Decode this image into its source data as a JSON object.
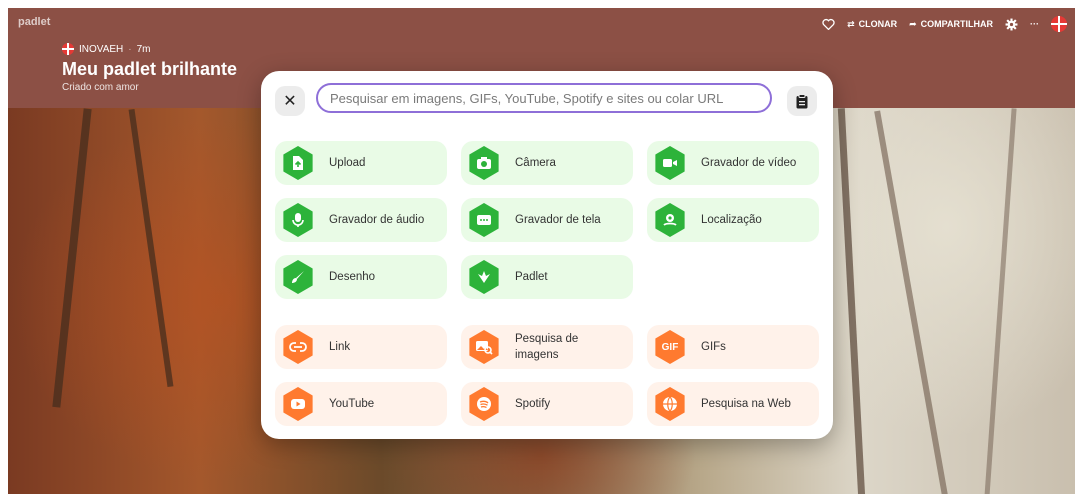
{
  "header": {
    "brand": "padlet",
    "author": "INOVAEH",
    "time": "7m",
    "title": "Meu padlet brilhante",
    "subtitle": "Criado com amor",
    "actions": {
      "clone": "CLONAR",
      "share": "COMPARTILHAR",
      "more": "···"
    }
  },
  "modal": {
    "close": "✕",
    "search_placeholder": "Pesquisar em imagens, GIFs, YouTube, Spotify e sites ou colar URL",
    "options": [
      {
        "label": "Upload",
        "icon": "upload-file-icon",
        "color": "#2db33a"
      },
      {
        "label": "Câmera",
        "icon": "camera-icon",
        "color": "#2db33a"
      },
      {
        "label": "Gravador de vídeo",
        "icon": "video-camera-icon",
        "color": "#2db33a"
      },
      {
        "label": "Gravador de áudio",
        "icon": "microphone-icon",
        "color": "#2db33a"
      },
      {
        "label": "Gravador de tela",
        "icon": "screen-recorder-icon",
        "color": "#2db33a"
      },
      {
        "label": "Localização",
        "icon": "location-icon",
        "color": "#2db33a"
      },
      {
        "label": "Desenho",
        "icon": "brush-icon",
        "color": "#2db33a"
      },
      {
        "label": "Padlet",
        "icon": "padlet-icon",
        "color": "#2db33a"
      },
      {
        "label": "Link",
        "icon": "link-icon",
        "color": "#ff7a2f"
      },
      {
        "label": "Pesquisa de imagens",
        "icon": "image-search-icon",
        "color": "#ff7a2f"
      },
      {
        "label": "GIFs",
        "icon": "gif-icon",
        "color": "#ff7a2f"
      },
      {
        "label": "YouTube",
        "icon": "youtube-icon",
        "color": "#ff7a2f"
      },
      {
        "label": "Spotify",
        "icon": "spotify-icon",
        "color": "#ff7a2f"
      },
      {
        "label": "Pesquisa na Web",
        "icon": "globe-icon",
        "color": "#ff7a2f"
      }
    ],
    "gif_text": "GIF"
  }
}
